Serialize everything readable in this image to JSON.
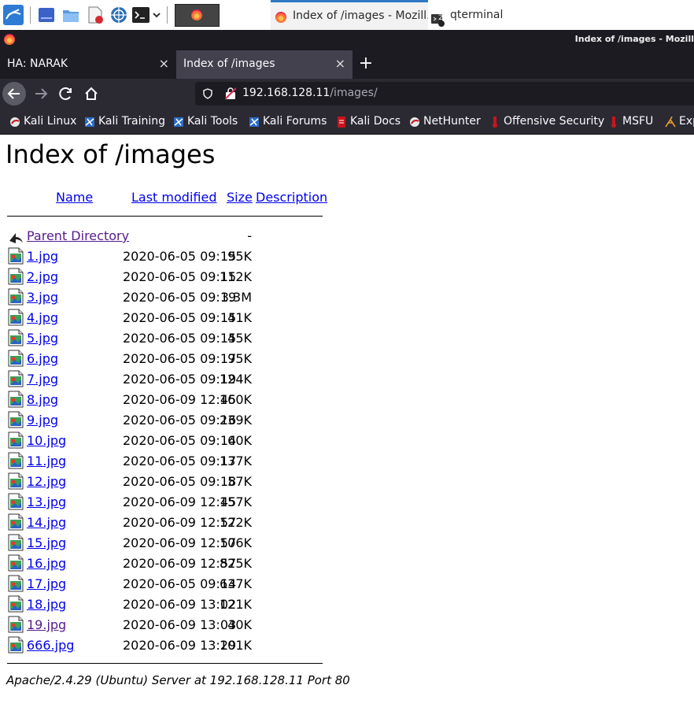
{
  "taskbar": {
    "windows": [
      {
        "title": "Index of /images - Mozill...",
        "active": true
      },
      {
        "title": "qterminal",
        "active": false,
        "badge": "2"
      }
    ]
  },
  "browser": {
    "window_title": "Index of /images - Mozill",
    "tabs": [
      {
        "label": "HA: NARAK",
        "close": "×",
        "selected": false
      },
      {
        "label": "Index of /images",
        "close": "×",
        "selected": true
      }
    ],
    "new_tab": "+",
    "url": {
      "host": "192.168.128.11",
      "path": "/images/"
    },
    "bookmarks": [
      "Kali Linux",
      "Kali Training",
      "Kali Tools",
      "Kali Forums",
      "Kali Docs",
      "NetHunter",
      "Offensive Security",
      "MSFU",
      "Exp"
    ]
  },
  "page": {
    "title": "Index of /images",
    "columns": {
      "name": "Name",
      "modified": "Last modified",
      "size": "Size",
      "description": "Description"
    },
    "parent": {
      "name": "Parent Directory",
      "size": "-"
    },
    "files": [
      {
        "name": "1.jpg",
        "modified": "2020-06-05 09:15",
        "size": "95K"
      },
      {
        "name": "2.jpg",
        "modified": "2020-06-05 09:15",
        "size": "112K"
      },
      {
        "name": "3.jpg",
        "modified": "2020-06-05 09:19",
        "size": "3.3M"
      },
      {
        "name": "4.jpg",
        "modified": "2020-06-05 09:15",
        "size": "41K"
      },
      {
        "name": "5.jpg",
        "modified": "2020-06-05 09:15",
        "size": "45K"
      },
      {
        "name": "6.jpg",
        "modified": "2020-06-05 09:17",
        "size": "95K"
      },
      {
        "name": "7.jpg",
        "modified": "2020-06-05 09:19",
        "size": "124K"
      },
      {
        "name": "8.jpg",
        "modified": "2020-06-09 12:45",
        "size": "160K"
      },
      {
        "name": "9.jpg",
        "modified": "2020-06-05 09:16",
        "size": "239K"
      },
      {
        "name": "10.jpg",
        "modified": "2020-06-05 09:14",
        "size": "60K"
      },
      {
        "name": "11.jpg",
        "modified": "2020-06-05 09:17",
        "size": "137K"
      },
      {
        "name": "12.jpg",
        "modified": "2020-06-05 09:18",
        "size": "57K"
      },
      {
        "name": "13.jpg",
        "modified": "2020-06-09 12:45",
        "size": "157K"
      },
      {
        "name": "14.jpg",
        "modified": "2020-06-09 12:57",
        "size": "122K"
      },
      {
        "name": "15.jpg",
        "modified": "2020-06-09 12:57",
        "size": "106K"
      },
      {
        "name": "16.jpg",
        "modified": "2020-06-09 12:57",
        "size": "825K"
      },
      {
        "name": "17.jpg",
        "modified": "2020-06-05 09:14",
        "size": "637K"
      },
      {
        "name": "18.jpg",
        "modified": "2020-06-09 13:02",
        "size": "121K"
      },
      {
        "name": "19.jpg",
        "modified": "2020-06-09 13:03",
        "size": "40K",
        "visited": true
      },
      {
        "name": "666.jpg",
        "modified": "2020-06-09 13:29",
        "size": "101K"
      }
    ],
    "address": "Apache/2.4.29 (Ubuntu) Server at 192.168.128.11 Port 80"
  },
  "colors": {
    "link": "#0000ee",
    "visited": "#551a8b",
    "accent": "#2f78c6"
  }
}
